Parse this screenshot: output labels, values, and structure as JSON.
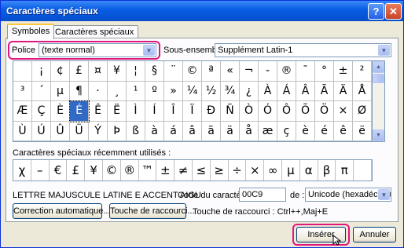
{
  "title": "Caractères spéciaux",
  "title_buttons": {
    "help": "?",
    "close": "✕"
  },
  "tabs": [
    {
      "label": "Symboles",
      "active": true
    },
    {
      "label": "Caractères spéciaux",
      "active": false
    }
  ],
  "font": {
    "label": "Police :",
    "value": "(texte normal)"
  },
  "subset": {
    "label": "Sous-ensemble :",
    "value": "Supplément Latin-1"
  },
  "symbols": [
    "",
    "¡",
    "¢",
    "£",
    "¤",
    "¥",
    "¦",
    "§",
    "¨",
    "©",
    "ª",
    "«",
    "¬",
    "-",
    "®",
    "¯",
    "°",
    "±",
    "²",
    "³",
    "´",
    "µ",
    "¶",
    "·",
    "¸",
    "¹",
    "º",
    "»",
    "¼",
    "½",
    "¾",
    "¿",
    "À",
    "Á",
    "Â",
    "Ã",
    "Ä",
    "Å",
    "Æ",
    "Ç",
    "È",
    "É",
    "Ê",
    "Ë",
    "Ì",
    "Í",
    "Î",
    "Ï",
    "Đ",
    "Ñ",
    "Ò",
    "Ó",
    "Ô",
    "Õ",
    "Ö",
    "×",
    "Ø",
    "Ù",
    "Ú",
    "Û",
    "Ü",
    "Ý",
    "Þ",
    "ß",
    "à",
    "á",
    "â",
    "ã",
    "ä",
    "å",
    "æ",
    "ç",
    "è",
    "é",
    "ê",
    "ë"
  ],
  "selected_symbol": "É",
  "recent_label": "Caractères spéciaux récemment utilisés :",
  "recent": [
    "χ",
    "–",
    "€",
    "£",
    "¥",
    "©",
    "®",
    "™",
    "±",
    "≠",
    "≤",
    "≥",
    "÷",
    "×",
    "∞",
    "µ",
    "α",
    "β",
    "π",
    ""
  ],
  "char_name": "LETTRE MAJUSCULE LATINE E ACCENT AIGU",
  "char_code": {
    "label": "Code du caractère :",
    "value": "00C9"
  },
  "from": {
    "label": "de :",
    "value": "Unicode (hexadécimal)"
  },
  "buttons": {
    "autocorrect": "Correction automatique...",
    "shortcut": "Touche de raccourci...",
    "insert": "Insérer",
    "cancel": "Annuler"
  },
  "shortcut_text": "Touche de raccourci : Ctrl++,Maj+E",
  "colors": {
    "highlight": "#e0177d",
    "selection": "#316ac5",
    "titlebar": "#0553d6"
  }
}
